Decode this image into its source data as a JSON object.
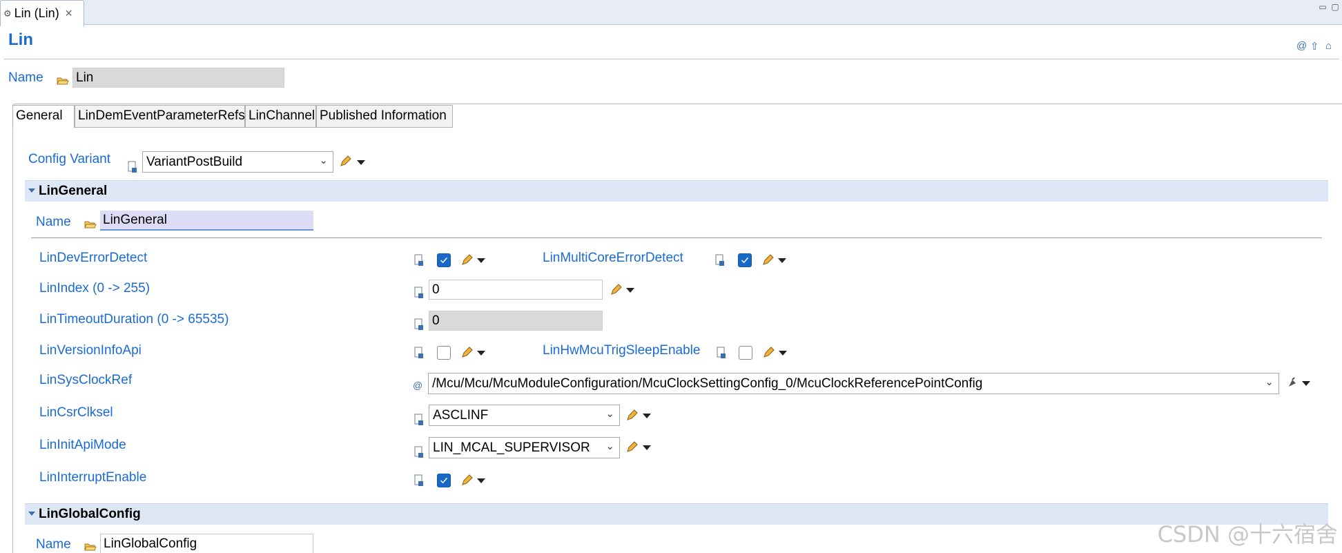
{
  "editor_tab": {
    "label": "Lin (Lin)"
  },
  "title": "Lin",
  "module_name": {
    "label": "Name",
    "value": "Lin"
  },
  "tabs": [
    "General",
    "LinDemEventParameterRefs",
    "LinChannel",
    "Published Information"
  ],
  "config_variant": {
    "label": "Config Variant",
    "value": "VariantPostBuild"
  },
  "lin_general": {
    "header": "LinGeneral",
    "name_label": "Name",
    "name_value": "LinGeneral",
    "params": {
      "dev_error_detect": {
        "label": "LinDevErrorDetect",
        "checked": true
      },
      "multi_core_error_detect": {
        "label": "LinMultiCoreErrorDetect",
        "checked": true
      },
      "index": {
        "label": "LinIndex (0 -> 255)",
        "value": "0"
      },
      "timeout_duration": {
        "label": "LinTimeoutDuration (0 -> 65535)",
        "value": "0"
      },
      "version_info_api": {
        "label": "LinVersionInfoApi",
        "checked": false
      },
      "hw_mcu_trig_sleep_enable": {
        "label": "LinHwMcuTrigSleepEnable",
        "checked": false
      },
      "sys_clock_ref": {
        "label": "LinSysClockRef",
        "value": "/Mcu/Mcu/McuModuleConfiguration/McuClockSettingConfig_0/McuClockReferencePointConfig"
      },
      "csr_clksel": {
        "label": "LinCsrClksel",
        "value": "ASCLINF"
      },
      "init_api_mode": {
        "label": "LinInitApiMode",
        "value": "LIN_MCAL_SUPERVISOR"
      },
      "interrupt_enable": {
        "label": "LinInterruptEnable",
        "checked": true
      }
    }
  },
  "lin_global_config": {
    "header": "LinGlobalConfig",
    "name_label": "Name",
    "name_value": "LinGlobalConfig"
  },
  "watermark": "CSDN @十六宿舍",
  "icons": {
    "tab": "module-icon",
    "close": "close-icon",
    "minimize": "minimize-icon",
    "maximize": "maximize-icon",
    "name": "folder-icon",
    "param": "parameter-doc-icon",
    "edit": "pencil-icon",
    "menu": "dropdown-triangle-icon"
  },
  "colors": {
    "link": "#1a6ad6",
    "section_bg": "#dde7f5",
    "checkbox_on": "#1868c8"
  }
}
